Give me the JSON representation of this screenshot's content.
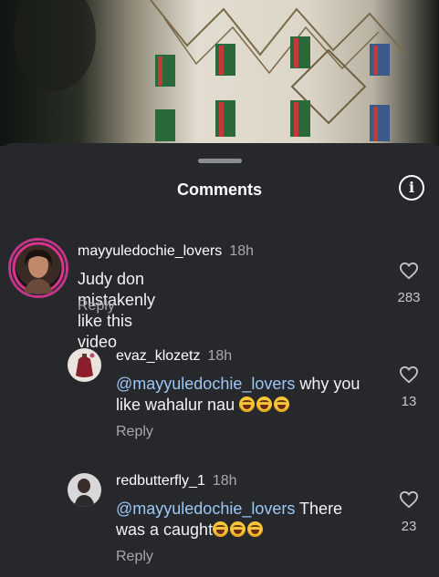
{
  "sheet": {
    "title": "Comments",
    "info_icon": "info-icon"
  },
  "comments": [
    {
      "username": "mayyuledochie_lovers",
      "time": "18h",
      "text": "Judy don mistakenly like this video",
      "reply_label": "Reply",
      "likes": "283"
    },
    {
      "username": "evaz_klozetz",
      "time": "18h",
      "mention": "@mayyuledochie_lovers",
      "text_line1": " why you",
      "text_line2": "like wahalur nau ",
      "emoji": "😂😂😂",
      "reply_label": "Reply",
      "likes": "13"
    },
    {
      "username": "redbutterfly_1",
      "time": "18h",
      "mention": "@mayyuledochie_lovers",
      "text_line1": " There",
      "text_line2": "was a caught",
      "emoji": "😂😂😂",
      "reply_label": "Reply",
      "likes": "23"
    }
  ],
  "colors": {
    "background": "#26282c",
    "mention": "#9cc7f5",
    "secondary_text": "#a6a9ae"
  }
}
